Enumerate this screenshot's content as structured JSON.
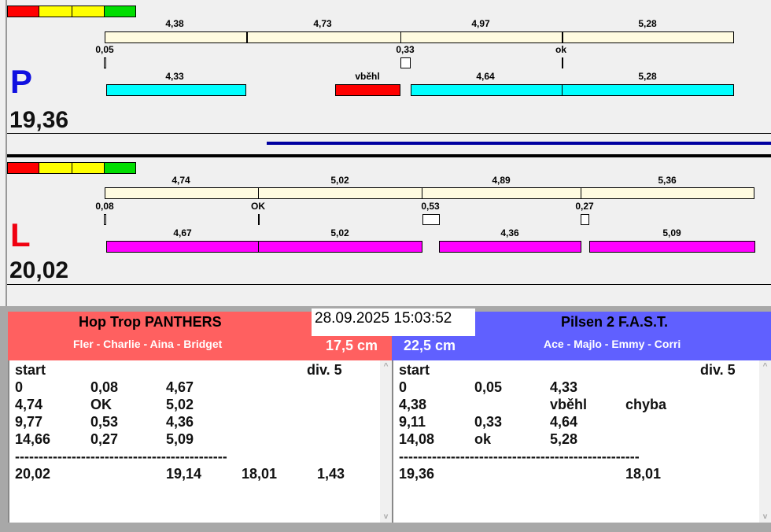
{
  "colors": {
    "legend": [
      "#ff0000",
      "#ffff00",
      "#ffff00",
      "#00dd00"
    ],
    "right_team": "#6060ff",
    "left_team": "#ff6060",
    "p_bars": "#00ffff",
    "l_bars": "#ff00ff",
    "false_start": "#ff0000",
    "lane_bar": "#fffbe0"
  },
  "lane_p": {
    "letter": "P",
    "total": "19,36",
    "splits": [
      "4,38",
      "4,73",
      "4,97",
      "5,28"
    ],
    "reactions": [
      "0,05",
      "0,33",
      "ok"
    ],
    "runs": [
      "4,33",
      "vběhl",
      "4,64",
      "5,28"
    ]
  },
  "lane_l": {
    "letter": "L",
    "total": "20,02",
    "splits": [
      "4,74",
      "5,02",
      "4,89",
      "5,36"
    ],
    "reactions": [
      "0,08",
      "OK",
      "0,53",
      "0,27"
    ],
    "runs": [
      "4,67",
      "5,02",
      "4,36",
      "5,09"
    ]
  },
  "timestamp": "28.09.2025 15:03:52",
  "left_team": {
    "name": "Hop Trop PANTHERS",
    "members": "Fler - Charlie - Aina - Bridget",
    "distance": "17,5 cm",
    "start": "start",
    "div": "div.  5",
    "rows": [
      [
        "0",
        "0,08",
        "4,67",
        "",
        ""
      ],
      [
        "4,74",
        "OK",
        "5,02",
        "",
        ""
      ],
      [
        "9,77",
        "0,53",
        "4,36",
        "",
        ""
      ],
      [
        "14,66",
        "0,27",
        "5,09",
        "",
        ""
      ]
    ],
    "separator": "---------------------------------------------",
    "total": [
      "20,02",
      "",
      "19,14",
      "18,01",
      "1,43"
    ]
  },
  "right_team": {
    "name": "Pilsen 2 F.A.S.T.",
    "members": "Ace - Majlo - Emmy - Corri",
    "distance": "22,5 cm",
    "start": "start",
    "div": "div.  5",
    "rows": [
      [
        "0",
        "0,05",
        "4,33",
        "",
        ""
      ],
      [
        "4,38",
        "",
        "vběhl",
        "chyba",
        ""
      ],
      [
        "9,11",
        "0,33",
        "4,64",
        "",
        ""
      ],
      [
        "14,08",
        "ok",
        "5,28",
        "",
        ""
      ]
    ],
    "separator": "---------------------------------------------------",
    "total": [
      "19,36",
      "",
      "",
      "18,01",
      ""
    ]
  }
}
